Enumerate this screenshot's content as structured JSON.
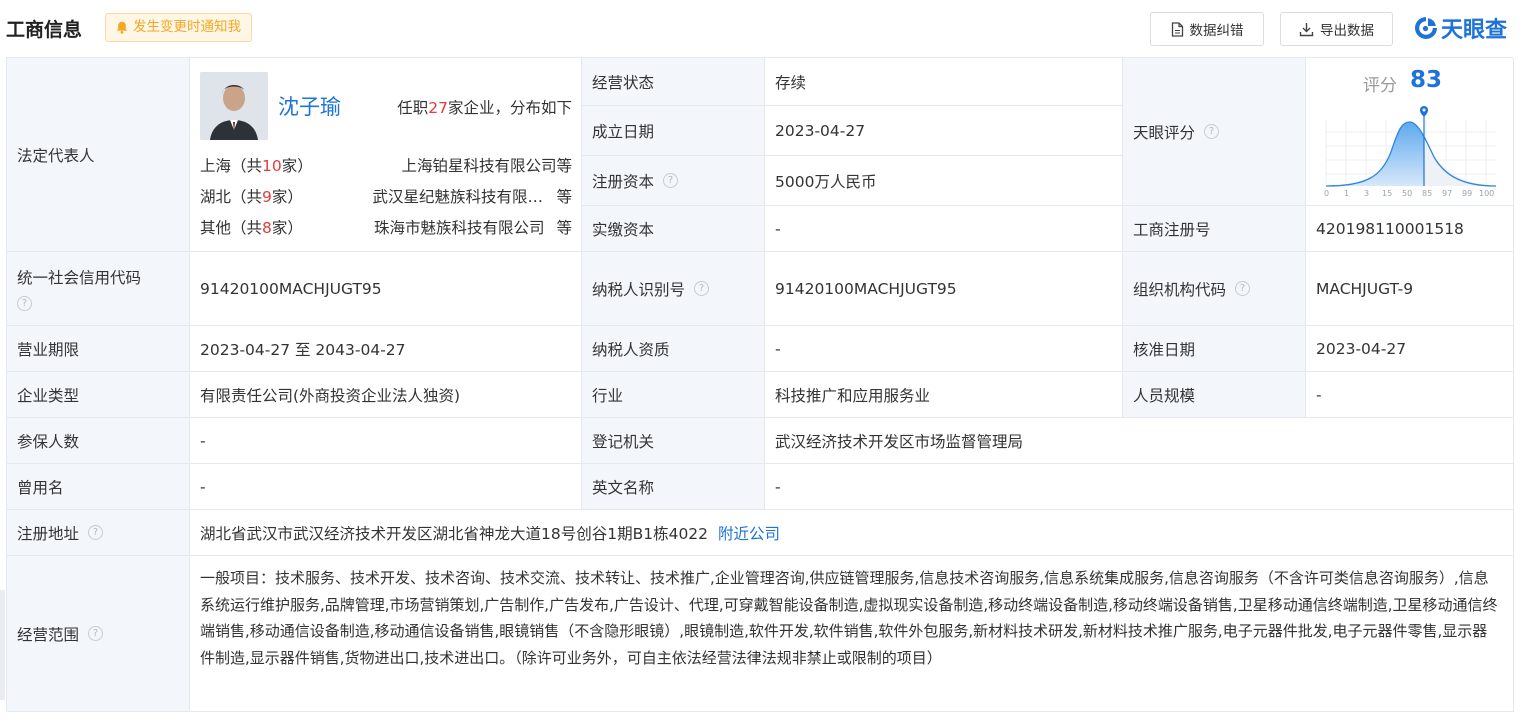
{
  "header": {
    "title": "工商信息",
    "notify_label": "发生变更时通知我",
    "correct_label": "数据纠错",
    "export_label": "导出数据",
    "brand": "天眼查"
  },
  "legal_rep": {
    "label": "法定代表人",
    "name": "沈子瑜",
    "count_prefix": "任职",
    "count": "27",
    "count_suffix": "家企业，分布如下",
    "regions": [
      {
        "region": "上海",
        "count": "10",
        "company": "上海铂星科技有限公司",
        "suffix": "等"
      },
      {
        "region": "湖北",
        "count": "9",
        "company": "武汉星纪魅族科技有限公司",
        "suffix": "等"
      },
      {
        "region": "其他",
        "count": "8",
        "company": "珠海市魅族科技有限公司",
        "suffix": "等"
      }
    ],
    "region_open": "（共",
    "region_close": "家）"
  },
  "fields": {
    "status_label": "经营状态",
    "status": "存续",
    "founded_label": "成立日期",
    "founded": "2023-04-27",
    "reg_capital_label": "注册资本",
    "reg_capital": "5000万人民币",
    "paid_capital_label": "实缴资本",
    "paid_capital": "-",
    "score_label": "天眼评分",
    "reg_no_label": "工商注册号",
    "reg_no": "420198110001518",
    "credit_code_label": "统一社会信用代码",
    "credit_code": "91420100MACHJUGT95",
    "taxpayer_id_label": "纳税人识别号",
    "taxpayer_id": "91420100MACHJUGT95",
    "org_code_label": "组织机构代码",
    "org_code": "MACHJUGT-9",
    "term_label": "营业期限",
    "term": "2023-04-27 至 2043-04-27",
    "tax_qual_label": "纳税人资质",
    "tax_qual": "-",
    "approve_label": "核准日期",
    "approve": "2023-04-27",
    "type_label": "企业类型",
    "type": "有限责任公司(外商投资企业法人独资)",
    "industry_label": "行业",
    "industry": "科技推广和应用服务业",
    "staff_label": "人员规模",
    "staff": "-",
    "insured_label": "参保人数",
    "insured": "-",
    "authority_label": "登记机关",
    "authority": "武汉经济技术开发区市场监督管理局",
    "former_label": "曾用名",
    "former": "-",
    "english_label": "英文名称",
    "english": "-",
    "address_label": "注册地址",
    "address": "湖北省武汉市武汉经济技术开发区湖北省神龙大道18号创谷1期B1栋4022",
    "nearby": "附近公司",
    "scope_label": "经营范围",
    "scope": "一般项目：技术服务、技术开发、技术咨询、技术交流、技术转让、技术推广,企业管理咨询,供应链管理服务,信息技术咨询服务,信息系统集成服务,信息咨询服务（不含许可类信息咨询服务）,信息系统运行维护服务,品牌管理,市场营销策划,广告制作,广告发布,广告设计、代理,可穿戴智能设备制造,虚拟现实设备制造,移动终端设备制造,移动终端设备销售,卫星移动通信终端制造,卫星移动通信终端销售,移动通信设备制造,移动通信设备销售,眼镜销售（不含隐形眼镜）,眼镜制造,软件开发,软件销售,软件外包服务,新材料技术研发,新材料技术推广服务,电子元器件批发,电子元器件零售,显示器件制造,显示器件销售,货物进出口,技术进出口。（除许可业务外，可自主依法经营法律法规非禁止或限制的项目）"
  },
  "score": {
    "label": "评分",
    "value": "83",
    "ticks": [
      "0",
      "1",
      "3",
      "15",
      "50",
      "85",
      "97",
      "99",
      "100"
    ],
    "accent": "#1d73d8"
  }
}
